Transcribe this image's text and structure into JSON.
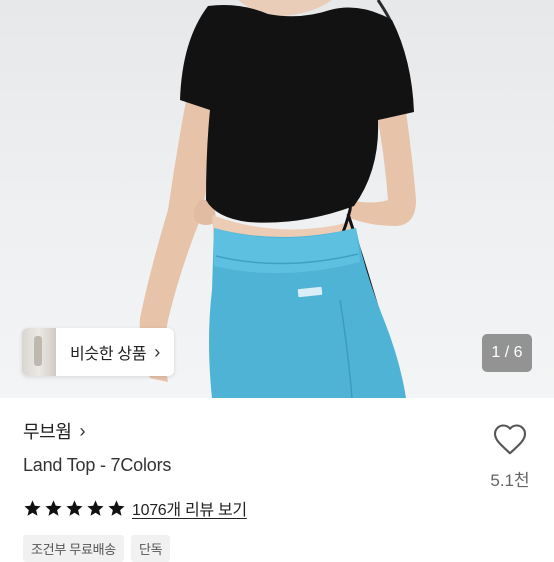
{
  "gallery": {
    "similar_products_label": "비슷한 상품",
    "page_indicator": "1 / 6"
  },
  "product": {
    "brand": "무브웜",
    "title": "Land Top - 7Colors",
    "likes": "5.1천",
    "rating_stars": 5,
    "review_link": "1076개 리뷰 보기",
    "tags": [
      "조건부 무료배송",
      "단독"
    ]
  },
  "icons": {
    "similar_chevron": "chevron-right-icon",
    "brand_chevron": "chevron-right-icon",
    "like": "heart-outline-icon",
    "rating": "star-icon"
  },
  "colors": {
    "top": "#111111",
    "pants": "#4fb3d6",
    "star": "#111111"
  }
}
